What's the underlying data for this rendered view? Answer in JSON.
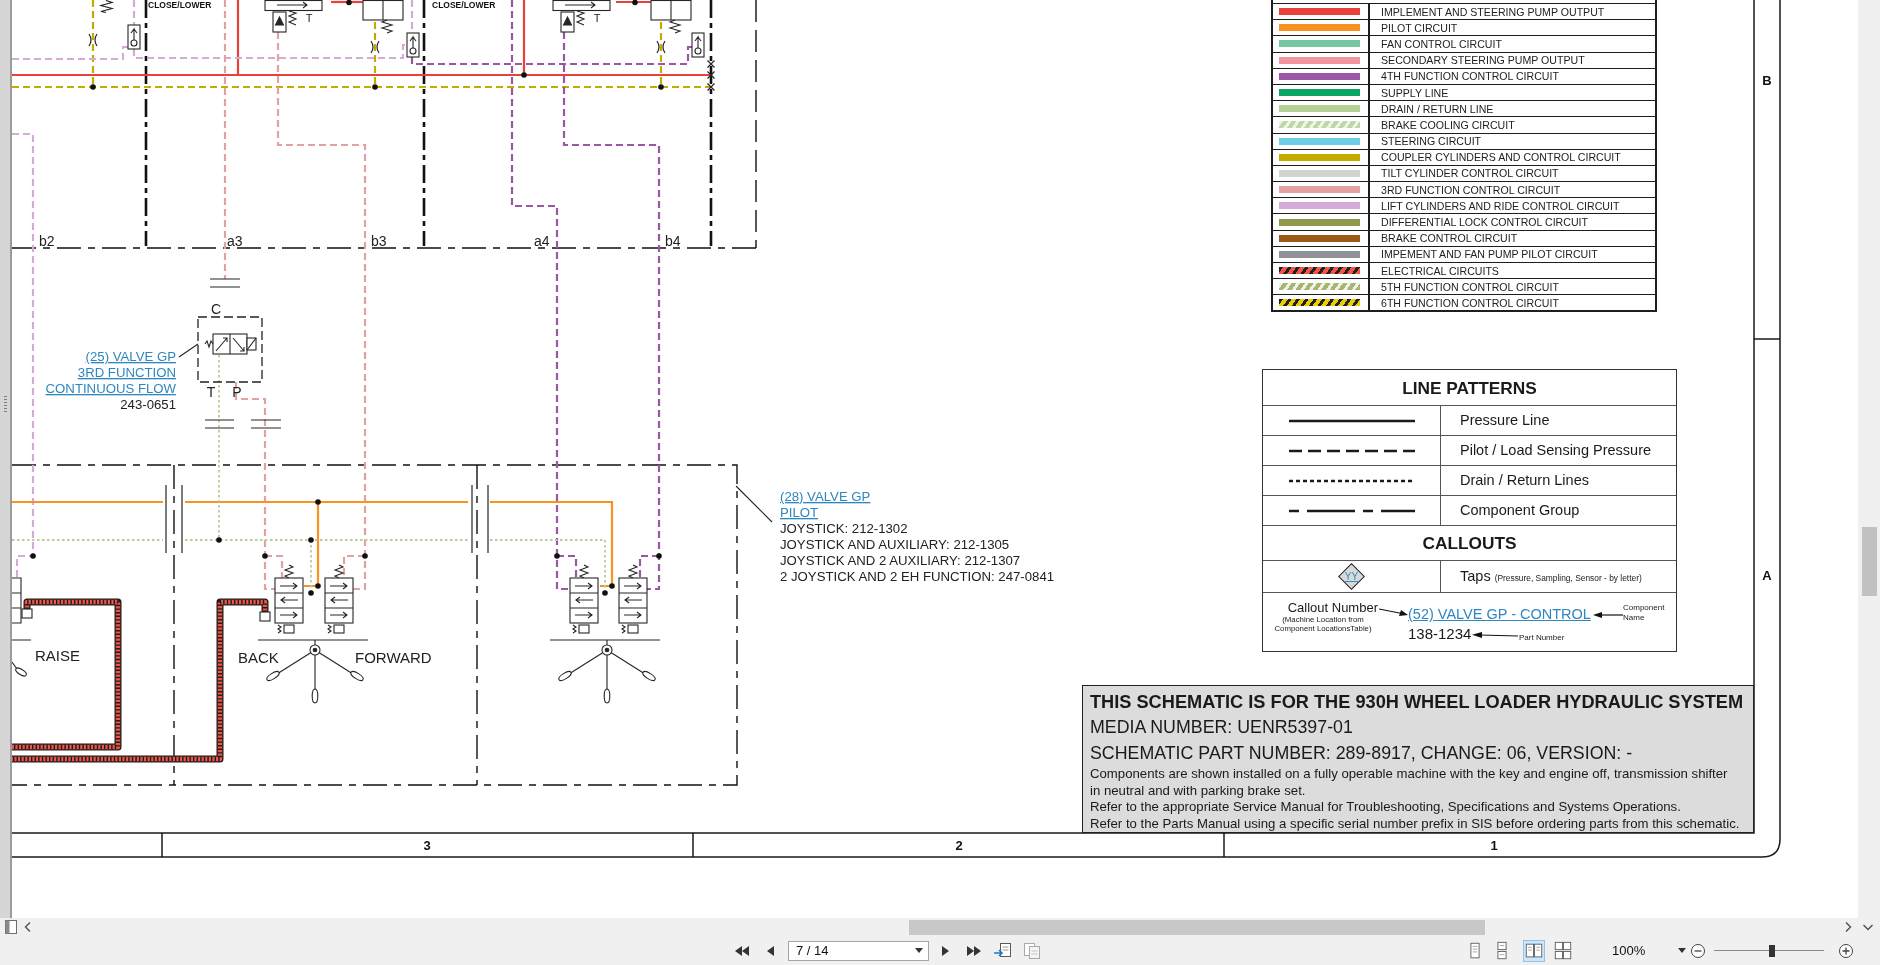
{
  "sheet": {
    "schematic": {
      "valve_labels": [
        "CLOSE/LOWER",
        "CLOSE/LOWER"
      ],
      "valve_port_labels": [
        "T",
        "T"
      ],
      "line_labels": [
        "b2",
        "a3",
        "b3",
        "a4",
        "b4"
      ],
      "coupler_label": "C",
      "valve_ports": [
        "T",
        "P"
      ],
      "callouts": [
        {
          "name_lines": [
            "(25) VALVE GP",
            "3RD FUNCTION",
            "CONTINUOUS FLOW"
          ],
          "part_numbers": [
            "243-0651"
          ]
        },
        {
          "name_lines": [
            "(28) VALVE GP",
            "PILOT"
          ],
          "part_numbers": [
            "JOYSTICK: 212-1302",
            "JOYSTICK AND AUXILIARY: 212-1305",
            "JOYSTICK AND 2 AUXILIARY: 212-1307",
            "2 JOYSTICK AND 2 EH FUNCTION: 247-0841"
          ]
        }
      ],
      "joystick_labels": [
        "RAISE",
        "BACK",
        "FORWARD"
      ]
    },
    "color_legend": [
      {
        "label": "IMPLEMENT AND STEERING PUMP OUTPUT",
        "kind": "solid",
        "color": "#e8413a"
      },
      {
        "label": "PILOT CIRCUIT",
        "kind": "solid",
        "color": "#f7931e"
      },
      {
        "label": "FAN CONTROL CIRCUIT",
        "kind": "solid",
        "color": "#74c7a1"
      },
      {
        "label": "SECONDARY STEERING PUMP OUTPUT",
        "kind": "solid",
        "color": "#f2949c"
      },
      {
        "label": "4TH FUNCTION CONTROL CIRCUIT",
        "kind": "solid",
        "color": "#9a57a6"
      },
      {
        "label": "SUPPLY LINE",
        "kind": "solid",
        "color": "#0ca463"
      },
      {
        "label": "DRAIN / RETURN LINE",
        "kind": "solid",
        "color": "#b4d097"
      },
      {
        "label": "BRAKE COOLING CIRCUIT",
        "kind": "hatched_light",
        "color": "#bcd8a4"
      },
      {
        "label": "STEERING CIRCUIT",
        "kind": "solid",
        "color": "#6fcde6"
      },
      {
        "label": "COUPLER CYLINDERS AND CONTROL CIRCUIT",
        "kind": "solid",
        "color": "#c4ab00"
      },
      {
        "label": "TILT CYLINDER CONTROL CIRCUIT",
        "kind": "solid",
        "color": "#d0d6cf"
      },
      {
        "label": "3RD FUNCTION CONTROL CIRCUIT",
        "kind": "solid",
        "color": "#e3a2a2"
      },
      {
        "label": "LIFT CYLINDERS AND RIDE CONTROL CIRCUIT",
        "kind": "solid",
        "color": "#d4abd8"
      },
      {
        "label": "DIFFERENTIAL LOCK CONTROL CIRCUIT",
        "kind": "solid",
        "color": "#8d9a4c"
      },
      {
        "label": "BRAKE CONTROL CIRCUIT",
        "kind": "solid",
        "color": "#9a5a16"
      },
      {
        "label": "IMPEMENT AND FAN PUMP PILOT CIRCUIT",
        "kind": "solid",
        "color": "#8f9297"
      },
      {
        "label": "ELECTRICAL CIRCUITS",
        "kind": "hatched_dark",
        "color": "#f05545"
      },
      {
        "label": "5TH FUNCTION CONTROL CIRCUIT",
        "kind": "hatched_light",
        "color": "#a6b56f"
      },
      {
        "label": "6TH FUNCTION CONTROL CIRCUIT",
        "kind": "hatched_dark",
        "color": "#e8d000"
      }
    ],
    "line_patterns": {
      "title": "LINE PATTERNS",
      "items": [
        {
          "kind": "solid",
          "label": "Pressure Line"
        },
        {
          "kind": "dashed",
          "label": "Pilot / Load Sensing Pressure"
        },
        {
          "kind": "dotted",
          "label": "Drain / Return Lines"
        },
        {
          "kind": "dash_dot",
          "label": "Component Group"
        }
      ]
    },
    "callouts": {
      "title": "CALLOUTS",
      "tap_symbol": "YY",
      "tap_label": "Taps",
      "tap_note": "(Pressure, Sampling, Sensor - by letter)",
      "callout_number_label": "Callout Number",
      "callout_number_note": "(Machine Location from Component LocationsTable)",
      "example_link": "(52) VALVE GP - CONTROL",
      "component_name_label": "Component Name",
      "example_part_number": "138-1234",
      "part_number_label": "Part Number"
    },
    "title_block": {
      "heading": "THIS SCHEMATIC IS FOR THE 930H WHEEL LOADER HYDRAULIC SYSTEM",
      "media_number": "MEDIA NUMBER: UENR5397-01",
      "part_number": "SCHEMATIC PART NUMBER: 289-8917, CHANGE: 06, VERSION: -",
      "notes": [
        "Components are shown installed on a fully operable machine with the key and engine off, transmission shifter in neutral and with parking brake set.",
        "Refer to the appropriate Service Manual for Troubleshooting, Specifications and Systems Operations.",
        "Refer to the Parts Manual using a specific serial number prefix in SIS before ordering parts from this schematic."
      ]
    },
    "zone_rows": [
      "B",
      "A"
    ],
    "zone_columns": [
      "3",
      "2",
      "1"
    ]
  },
  "toolbar": {
    "page_field": {
      "value": "7 / 14"
    },
    "view_modes": [
      {
        "selected": false
      },
      {
        "selected": false
      },
      {
        "selected": true
      },
      {
        "selected": false
      }
    ],
    "zoom": {
      "value": "100%",
      "level": 0.53
    }
  }
}
